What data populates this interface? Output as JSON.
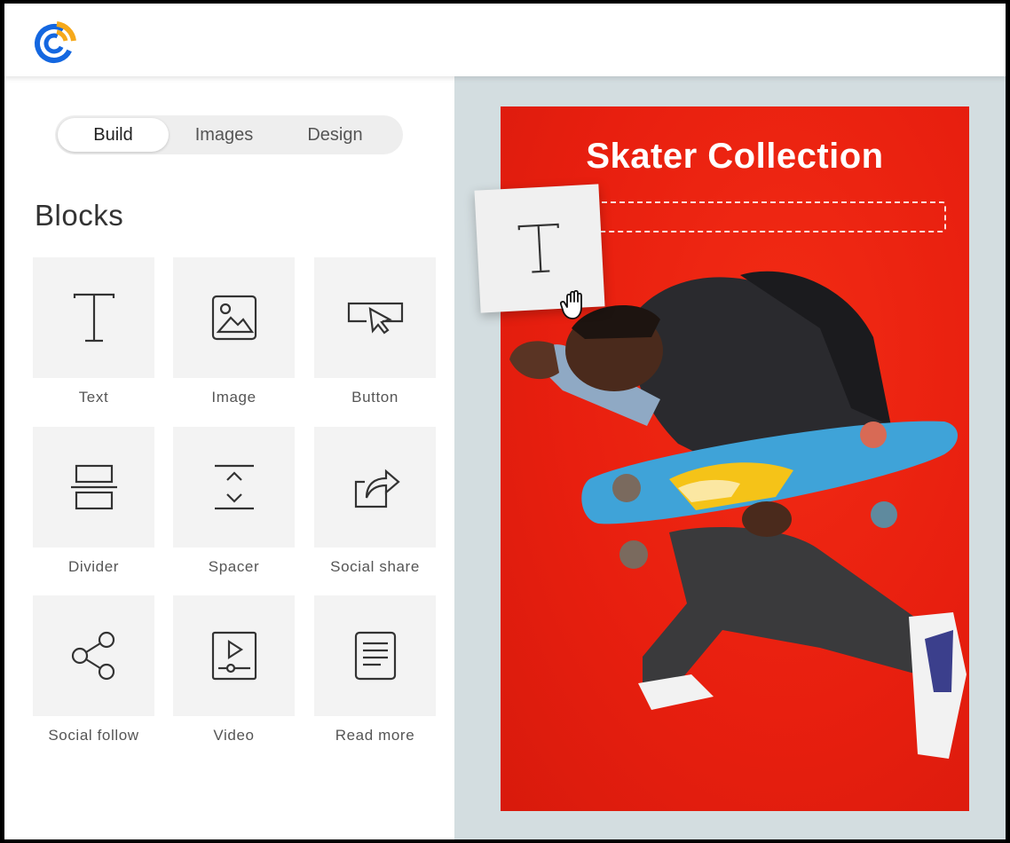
{
  "tabs": [
    {
      "label": "Build",
      "active": true
    },
    {
      "label": "Images",
      "active": false
    },
    {
      "label": "Design",
      "active": false
    }
  ],
  "blocks": {
    "title": "Blocks",
    "items": [
      {
        "label": "Text",
        "icon": "text-icon"
      },
      {
        "label": "Image",
        "icon": "image-icon"
      },
      {
        "label": "Button",
        "icon": "button-icon"
      },
      {
        "label": "Divider",
        "icon": "divider-icon"
      },
      {
        "label": "Spacer",
        "icon": "spacer-icon"
      },
      {
        "label": "Social share",
        "icon": "social-share-icon"
      },
      {
        "label": "Social follow",
        "icon": "social-follow-icon"
      },
      {
        "label": "Video",
        "icon": "video-icon"
      },
      {
        "label": "Read more",
        "icon": "read-more-icon"
      }
    ]
  },
  "canvas": {
    "title": "Skater Collection",
    "background_color": "#e81f0f"
  },
  "drag": {
    "block": "text-icon",
    "cursor": "grab-hand-icon"
  },
  "colors": {
    "logo_blue": "#1467e0",
    "logo_orange": "#f6a91b",
    "preview_bg": "#d3dde0"
  }
}
